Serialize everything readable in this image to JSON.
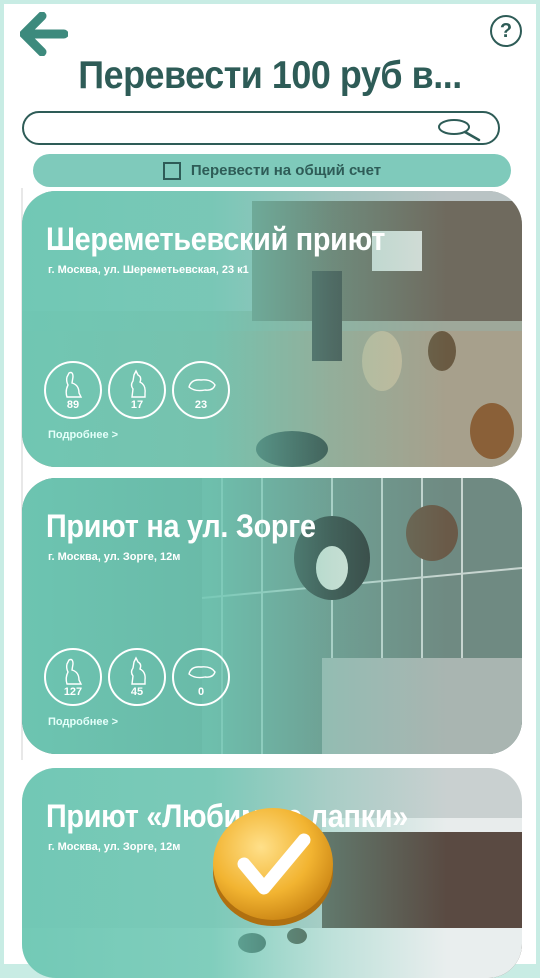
{
  "header": {
    "title": "Перевести 100 руб в...",
    "back_icon": "back-arrow-icon",
    "help_label": "?"
  },
  "search": {
    "value": "",
    "placeholder": ""
  },
  "general_account": {
    "label": "Перевести на общий счет",
    "checked": false
  },
  "shelters": [
    {
      "name": "Шереметьевский приют",
      "address": "г. Москва, ул. Шереметьевская, 23 к1",
      "dogs": "89",
      "puppies": "17",
      "other": "23",
      "more": "Подробнее >"
    },
    {
      "name": "Приют на ул. Зорге",
      "address": "г. Москва, ул. Зорге, 12м",
      "dogs": "127",
      "puppies": "45",
      "other": "0",
      "more": "Подробнее >"
    },
    {
      "name": "Приют «Любимые лапки»",
      "address": "г. Москва, ул. Зорге, 12м"
    }
  ],
  "confirm": {
    "icon": "checkmark-icon"
  },
  "colors": {
    "accent": "#2e5c57",
    "teal": "#7fcabb",
    "gold": "#f2b431"
  }
}
